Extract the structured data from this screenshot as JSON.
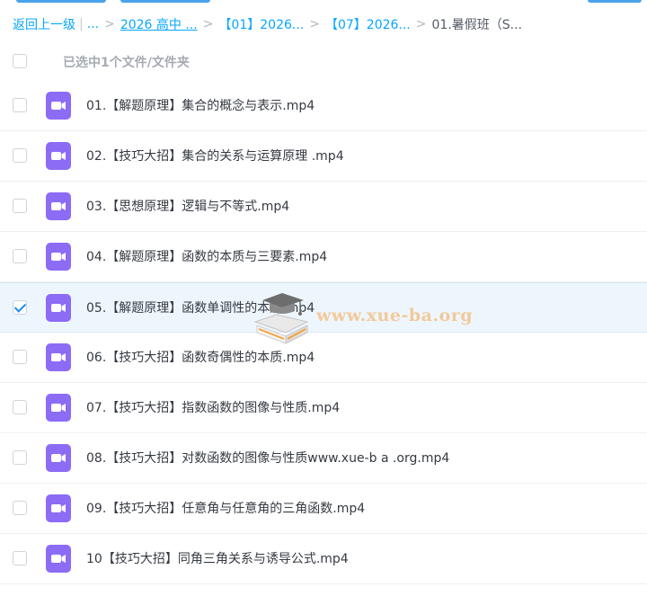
{
  "breadcrumb": {
    "back": "返回上一级",
    "ellipsis": "...",
    "crumbs": [
      "2026 高中 ...",
      "【01】2026...",
      "【07】2026..."
    ],
    "current": "01.暑假班（S..."
  },
  "selection": {
    "label": "已选中1个文件/文件夹"
  },
  "files": [
    {
      "name": "01.【解题原理】集合的概念与表示.mp4",
      "icon": "video-file-icon",
      "checked": false
    },
    {
      "name": "02.【技巧大招】集合的关系与运算原理 .mp4",
      "icon": "video-file-icon",
      "checked": false
    },
    {
      "name": "03.【思想原理】逻辑与不等式.mp4",
      "icon": "video-file-icon",
      "checked": false
    },
    {
      "name": "04.【解题原理】函数的本质与三要素.mp4",
      "icon": "video-file-icon",
      "checked": false
    },
    {
      "name": "05.【解题原理】函数单调性的本质.mp4",
      "icon": "video-file-icon",
      "checked": true
    },
    {
      "name": "06.【技巧大招】函数奇偶性的本质.mp4",
      "icon": "video-file-icon",
      "checked": false
    },
    {
      "name": "07.【技巧大招】指数函数的图像与性质.mp4",
      "icon": "video-file-icon",
      "checked": false
    },
    {
      "name": "08.【技巧大招】对数函数的图像与性质www.xue-b a .org.mp4",
      "icon": "video-file-icon",
      "checked": false
    },
    {
      "name": "09.【技巧大招】任意角与任意角的三角函数.mp4",
      "icon": "video-file-icon",
      "checked": false
    },
    {
      "name": "10【技巧大招】同角三角关系与诱导公式.mp4",
      "icon": "video-file-icon",
      "checked": false
    }
  ],
  "watermark": {
    "text": "www.xue-ba.org",
    "icon": "graduation-cap-book-icon"
  },
  "colors": {
    "link": "#06a7ff",
    "video_icon": "#8c6bf5",
    "selected_row": "#eef6fd",
    "checkmark": "#1c8cf0"
  }
}
